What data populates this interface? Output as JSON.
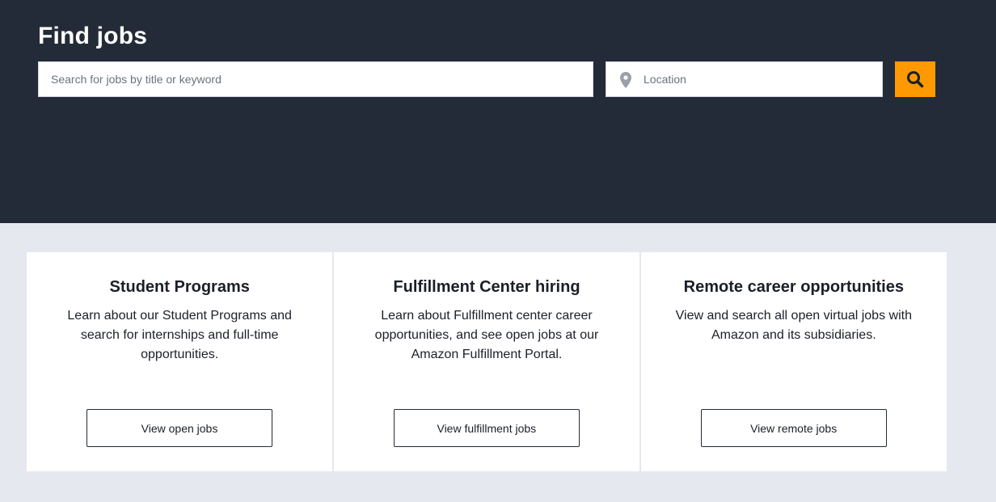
{
  "hero": {
    "title": "Find jobs",
    "search": {
      "placeholder": "Search for jobs by title or keyword",
      "value": ""
    },
    "location": {
      "placeholder": "Location",
      "value": ""
    },
    "search_button": {
      "icon": "search-icon",
      "background": "#ff9900"
    },
    "background": "#232b38"
  },
  "cards": [
    {
      "title": "Student Programs",
      "description": "Learn about our Student Programs and search for internships and full-time opportunities.",
      "button_label": "View open jobs"
    },
    {
      "title": "Fulfillment Center hiring",
      "description": "Learn about Fulfillment center career opportunities, and see open jobs at our Amazon Fulfillment Portal.",
      "button_label": "View fulfillment jobs"
    },
    {
      "title": "Remote career opportunities",
      "description": "View and search all open virtual jobs with Amazon and its subsidiaries.",
      "button_label": "View remote jobs"
    }
  ],
  "colors": {
    "page_background": "#e5e8ef",
    "card_background": "#ffffff",
    "accent": "#ff9900"
  }
}
